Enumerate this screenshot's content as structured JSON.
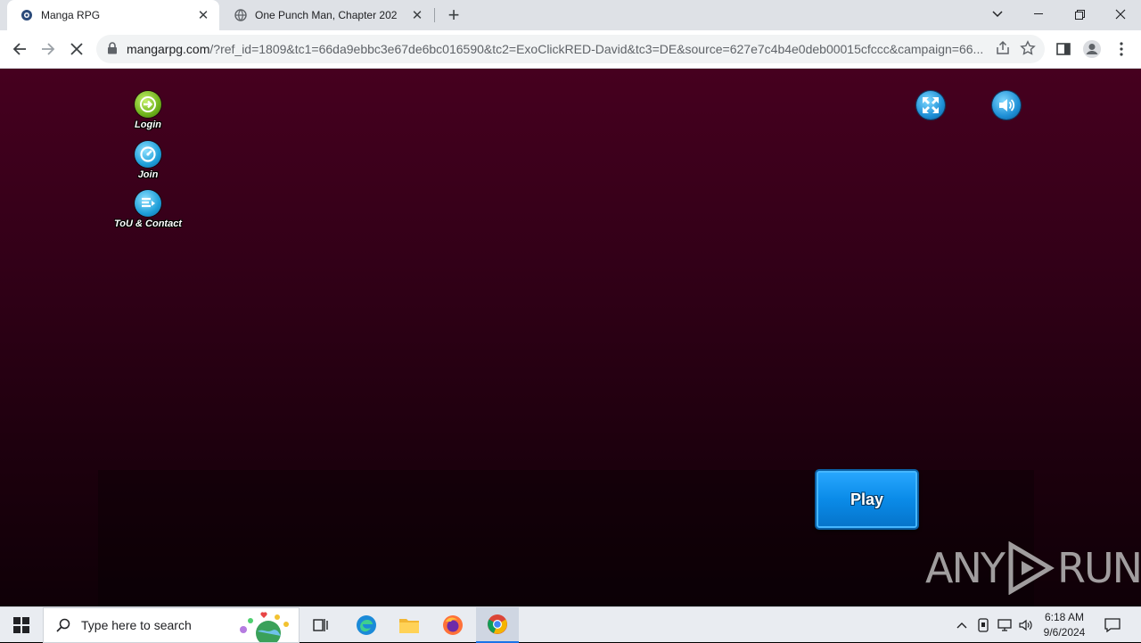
{
  "browser": {
    "tabs": [
      {
        "title": "Manga RPG",
        "active": true
      },
      {
        "title": "One Punch Man, Chapter 202",
        "active": false
      }
    ],
    "new_tab_icon": "plus-icon",
    "url_host": "mangarpg.com",
    "url_rest": "/?ref_id=1809&tc1=66da9ebbc3e67de6bc016590&tc2=ExoClickRED-David&tc3=DE&source=627e7c4b4e0deb00015cfccc&campaign=66..."
  },
  "game": {
    "side_menu": [
      {
        "label": "Login",
        "icon": "login-arrow-icon",
        "color": "#7cc22a"
      },
      {
        "label": "Join",
        "icon": "join-icon",
        "color": "#1e9fd9"
      },
      {
        "label": "ToU & Contact",
        "icon": "document-icon",
        "color": "#1e9fd9"
      }
    ],
    "fullscreen_icon": "fullscreen-icon",
    "sound_icon": "speaker-icon",
    "play_label": "Play"
  },
  "watermark": {
    "left": "ANY",
    "right": "RUN"
  },
  "taskbar": {
    "search_placeholder": "Type here to search",
    "time": "6:18 AM",
    "date": "9/6/2024"
  },
  "colors": {
    "page_top": "#46001f",
    "page_bottom": "#0f0007",
    "play_button": "#0a8be8"
  }
}
